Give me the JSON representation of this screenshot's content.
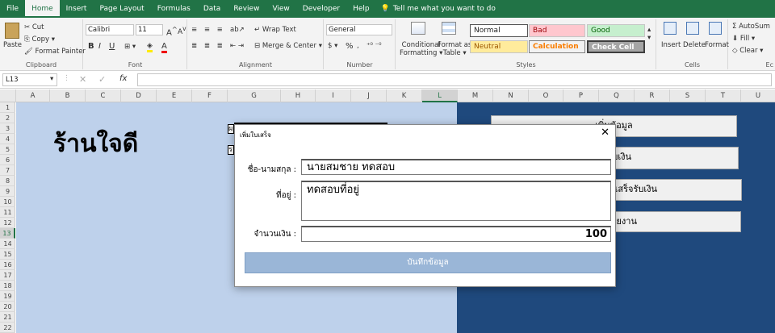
{
  "tabs": [
    "File",
    "Home",
    "Insert",
    "Page Layout",
    "Formulas",
    "Data",
    "Review",
    "View",
    "Developer",
    "Help"
  ],
  "tell_me": "Tell me what you want to do",
  "ribbon": {
    "clipboard": {
      "label": "Clipboard",
      "paste": "Paste",
      "cut": "Cut",
      "copy": "Copy",
      "format_painter": "Format Painter"
    },
    "font": {
      "label": "Font",
      "name": "Calibri",
      "size": "11",
      "bold": "B",
      "italic": "I",
      "underline": "U"
    },
    "alignment": {
      "label": "Alignment",
      "wrap_text": "Wrap Text",
      "merge_center": "Merge & Center"
    },
    "number": {
      "label": "Number",
      "format": "General",
      "percent": "%"
    },
    "styles": {
      "label": "Styles",
      "conditional": [
        "Conditional",
        "Formatting"
      ],
      "format_as_table": [
        "Format as",
        "Table"
      ],
      "normal": "Normal",
      "bad": "Bad",
      "good": "Good",
      "neutral": "Neutral",
      "calculation": "Calculation",
      "check_cell": "Check Cell"
    },
    "cells": {
      "label": "Cells",
      "insert": "Insert",
      "delete": "Delete",
      "format": "Format"
    },
    "editing": {
      "autosum": "AutoSum",
      "fill": "Fill",
      "clear": "Clear",
      "label": "Ec"
    }
  },
  "formula_bar": {
    "name_box": "L13",
    "fx": "fx",
    "formula": ""
  },
  "columns": [
    "A",
    "B",
    "C",
    "D",
    "E",
    "F",
    "G",
    "H",
    "I",
    "J",
    "K",
    "L",
    "M",
    "N",
    "O",
    "P",
    "Q",
    "R",
    "S",
    "T",
    "U"
  ],
  "rows": [
    "1",
    "2",
    "3",
    "4",
    "5",
    "6",
    "7",
    "8",
    "9",
    "10",
    "11",
    "12",
    "13",
    "14",
    "15",
    "16",
    "17",
    "18",
    "19",
    "20",
    "21",
    "22"
  ],
  "sheet": {
    "shop_name": "ร้านใจดี",
    "box1": "ผ",
    "box2": "ร",
    "buttons": [
      "เพิ่มข้อมูล",
      "พิมพ์ใบเสร็จรับเงิน",
      "พิมพ์ใบเสร็จรับเงิน",
      "รายงาน"
    ]
  },
  "dialog": {
    "title": "เพิ่มใบเสร็จ",
    "close": "✕",
    "name_label": "ชื่อ-นามสกุล :",
    "name_value": "นายสมชาย ทดสอบ",
    "address_label": "ที่อยู่ :",
    "address_value": "ทดสอบที่อยู่",
    "amount_label": "จำนวนเงิน :",
    "amount_value": "100",
    "save": "บันทึกข้อมูล"
  },
  "colors": {
    "excel_green": "#217346",
    "sheet_left": "#bed1eb",
    "sheet_right": "#1f497d",
    "save_button": "#9ab6d7"
  }
}
